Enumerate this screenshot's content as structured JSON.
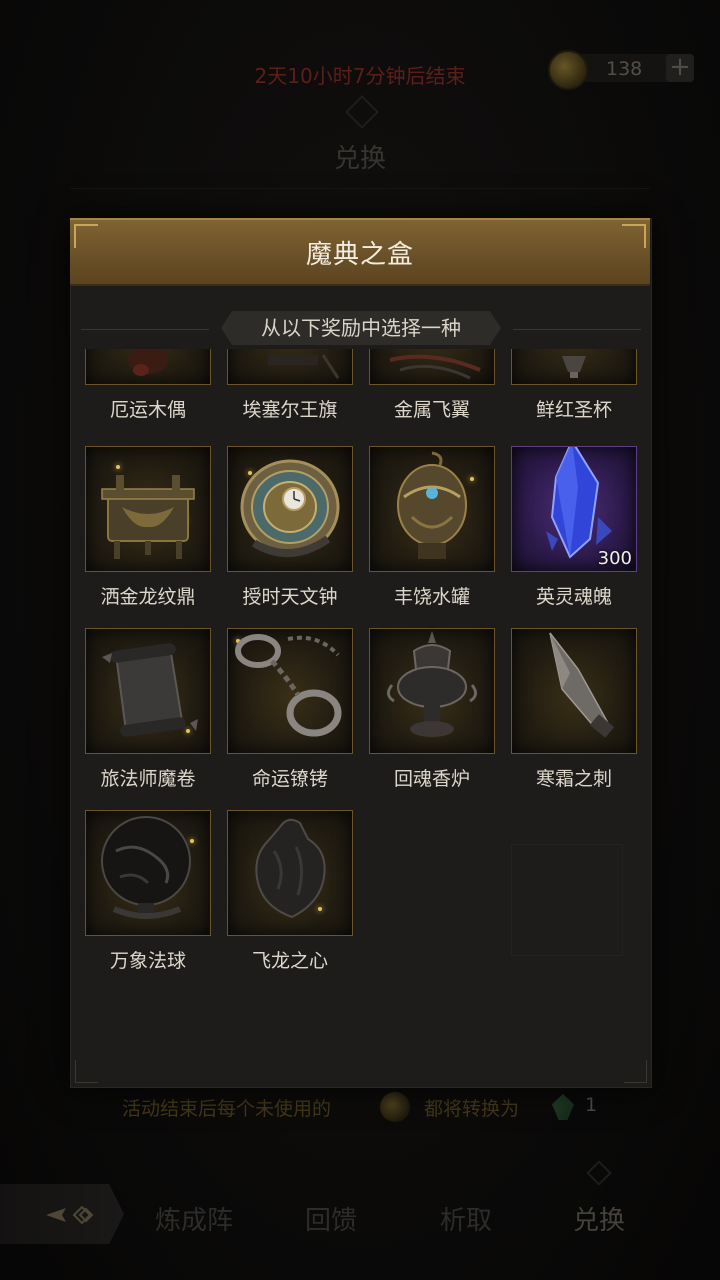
{
  "header": {
    "timer_text": "2天10小时7分钟后结束",
    "currency_amount": "138",
    "currency_add_label": "+",
    "page_title": "兑换"
  },
  "modal": {
    "title": "魔典之盒",
    "subtitle": "从以下奖励中选择一种",
    "items": [
      {
        "label": "厄运木偶",
        "icon": "cursed-doll-icon"
      },
      {
        "label": "埃塞尔王旗",
        "icon": "royal-banner-icon"
      },
      {
        "label": "金属飞翼",
        "icon": "metal-wing-icon"
      },
      {
        "label": "鲜红圣杯",
        "icon": "crimson-grail-icon"
      },
      {
        "label": "洒金龙纹鼎",
        "icon": "dragon-cauldron-icon"
      },
      {
        "label": "授时天文钟",
        "icon": "astronomical-clock-icon"
      },
      {
        "label": "丰饶水罐",
        "icon": "water-jar-icon"
      },
      {
        "label": "英灵魂魄",
        "icon": "soul-crystal-icon",
        "count": "300",
        "rarity_color": "#5e3f86"
      },
      {
        "label": "旅法师魔卷",
        "icon": "magic-scroll-icon"
      },
      {
        "label": "命运镣铐",
        "icon": "fate-shackles-icon"
      },
      {
        "label": "回魂香炉",
        "icon": "incense-burner-icon"
      },
      {
        "label": "寒霜之刺",
        "icon": "frost-thorn-icon"
      },
      {
        "label": "万象法球",
        "icon": "magic-orb-icon"
      },
      {
        "label": "飞龙之心",
        "icon": "dragon-heart-icon"
      }
    ]
  },
  "footer_note": {
    "text_before": "活动结束后每个未使用的",
    "text_after": "都将转换为",
    "quantity": "1"
  },
  "bottom_nav": {
    "tabs": [
      "炼成阵",
      "回馈",
      "析取",
      "兑换"
    ],
    "active_tab": "兑换"
  },
  "colors": {
    "accent_gold": "#806432",
    "timer_red": "#7a2a22",
    "epic_purple": "#5e3f86"
  }
}
